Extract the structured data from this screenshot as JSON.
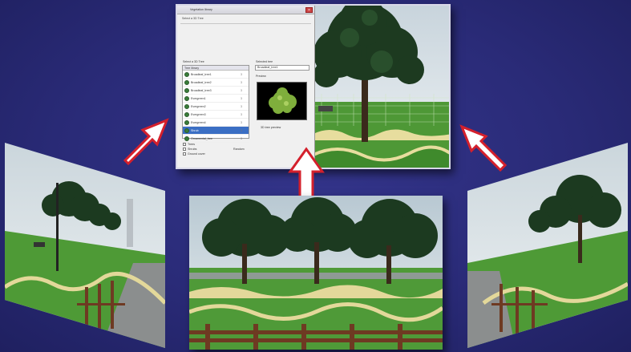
{
  "colors": {
    "background": "#2c2d7e",
    "arrow_fill": "#ffffff",
    "arrow_stroke": "#d4202c",
    "grass": "#4f9a38",
    "sky": "#dfe9ee",
    "tree": "#1f3a22",
    "fence": "#6e3a22",
    "selected_row": "#3b6fc4"
  },
  "dialog": {
    "title": "Vegetation library",
    "subtitle": "Select a 3D Tree",
    "library_label": "Select a 3D Tree",
    "library_header": "Tree library",
    "items": [
      {
        "name": "Broadleaf_tree1",
        "flag": "3",
        "selected": false
      },
      {
        "name": "Broadleaf_tree2",
        "flag": "3",
        "selected": false
      },
      {
        "name": "Broadleaf_tree3",
        "flag": "3",
        "selected": false
      },
      {
        "name": "Evergreen1",
        "flag": "3",
        "selected": false
      },
      {
        "name": "Evergreen2",
        "flag": "3",
        "selected": false
      },
      {
        "name": "Evergreen3",
        "flag": "3",
        "selected": false
      },
      {
        "name": "Evergreen4",
        "flag": "3",
        "selected": false
      },
      {
        "name": "Shrub",
        "flag": "3",
        "selected": true
      },
      {
        "name": "Ornamental_tree",
        "flag": "3",
        "selected": false
      }
    ],
    "selection_label": "Selected tree",
    "selection_value": "Broadleaf_tree1",
    "preview_label": "Preview",
    "preview_caption": "3D tree preview",
    "options": [
      {
        "label": "Trees"
      },
      {
        "label": "Shrubs"
      },
      {
        "label": "Ground cover"
      }
    ],
    "random_label": "Random",
    "icons": {
      "item": "tree-icon",
      "close": "close-icon"
    }
  }
}
